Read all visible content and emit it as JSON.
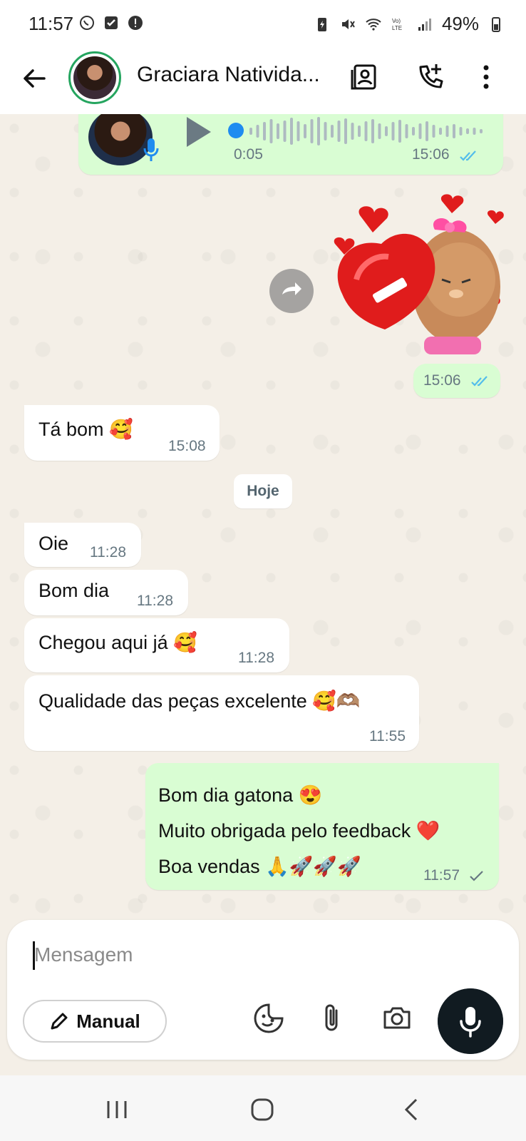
{
  "status_bar": {
    "time": "11:57",
    "battery": "49%"
  },
  "header": {
    "contact_name": "Graciara Nativida..."
  },
  "messages": {
    "voice": {
      "duration": "0:05",
      "time": "15:06"
    },
    "sticker": {
      "time": "15:06"
    },
    "in_1": {
      "text": "Tá bom 🥰",
      "time": "15:08"
    },
    "date_chip": "Hoje",
    "in_2": {
      "text": "Oie",
      "time": "11:28"
    },
    "in_3": {
      "text": "Bom dia",
      "time": "11:28"
    },
    "in_4": {
      "text": "Chegou aqui já 🥰",
      "time": "11:28"
    },
    "in_5": {
      "text": "Qualidade das peças excelente 🥰🫶🏽",
      "time": "11:55"
    },
    "out_1": {
      "lines": [
        "Bom dia gatona 😍",
        "Muito obrigada pelo feedback ❤️",
        "Boa vendas 🙏🚀🚀🚀"
      ],
      "time": "11:57"
    }
  },
  "composer": {
    "placeholder": "Mensagem",
    "manual_label": "Manual"
  },
  "colors": {
    "incoming": "#ffffff",
    "outgoing": "#d9fdd3",
    "accent": "#25a55f",
    "read_ticks": "#53bdeb",
    "mic_button": "#111b21"
  }
}
